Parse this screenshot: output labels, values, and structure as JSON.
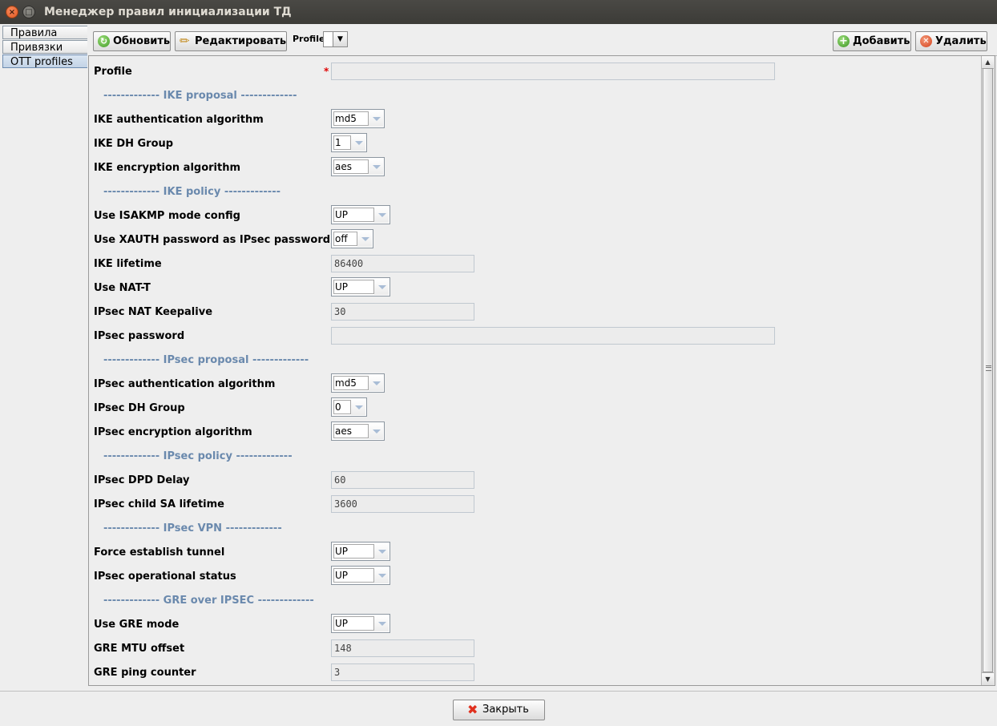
{
  "window": {
    "title": "Менеджер правил инициализации ТД",
    "close_glyph": "×",
    "max_glyph": "□"
  },
  "side_tabs": [
    {
      "label": "Правила"
    },
    {
      "label": "Привязки"
    },
    {
      "label": "OTT profiles",
      "active": true
    }
  ],
  "toolbar": {
    "refresh_label": "Обновить",
    "edit_label": "Редактировать",
    "profile_label": "Profile",
    "profile_value": "",
    "add_label": "Добавить",
    "delete_label": "Удалить"
  },
  "form": {
    "profile": {
      "label": "Profile",
      "required_mark": "*",
      "value": ""
    },
    "sections": {
      "ike_proposal": "------------- IKE proposal -------------",
      "ike_policy": "------------- IKE policy -------------",
      "ipsec_proposal": "------------- IPsec proposal -------------",
      "ipsec_policy": "------------- IPsec policy -------------",
      "ipsec_vpn": "------------- IPsec VPN -------------",
      "gre": "------------- GRE over IPSEC -------------"
    },
    "ike_auth": {
      "label": "IKE authentication algorithm",
      "value": "md5"
    },
    "ike_dh": {
      "label": "IKE DH Group",
      "value": "1"
    },
    "ike_enc": {
      "label": "IKE encryption algorithm",
      "value": "aes"
    },
    "isakmp": {
      "label": "Use ISAKMP mode config",
      "value": "UP"
    },
    "xauth": {
      "label": "Use XAUTH password as IPsec password",
      "value": "off"
    },
    "ike_lifetime": {
      "label": "IKE lifetime",
      "value": "86400"
    },
    "nat_t": {
      "label": "Use NAT-T",
      "value": "UP"
    },
    "nat_keepalive": {
      "label": "IPsec NAT Keepalive",
      "value": "30"
    },
    "ipsec_password": {
      "label": "IPsec password",
      "value": ""
    },
    "ipsec_auth": {
      "label": "IPsec authentication algorithm",
      "value": "md5"
    },
    "ipsec_dh": {
      "label": "IPsec DH Group",
      "value": "0"
    },
    "ipsec_enc": {
      "label": "IPsec encryption algorithm",
      "value": "aes"
    },
    "dpd_delay": {
      "label": "IPsec DPD Delay",
      "value": "60"
    },
    "child_sa": {
      "label": "IPsec child SA lifetime",
      "value": "3600"
    },
    "force_tunnel": {
      "label": "Force establish tunnel",
      "value": "UP"
    },
    "oper_status": {
      "label": "IPsec operational status",
      "value": "UP"
    },
    "gre_mode": {
      "label": "Use GRE mode",
      "value": "UP"
    },
    "gre_mtu": {
      "label": "GRE MTU offset",
      "value": "148"
    },
    "gre_ping": {
      "label": "GRE ping counter",
      "value": "3"
    }
  },
  "footer": {
    "close_label": "Закрыть"
  },
  "icons": {
    "refresh": "refresh-icon",
    "edit": "pencil-icon",
    "add": "add-icon",
    "delete": "delete-icon",
    "close": "close-icon"
  },
  "colors": {
    "section": "#6a89ad",
    "required": "#e00000",
    "titlebar": "#3c3b37"
  }
}
